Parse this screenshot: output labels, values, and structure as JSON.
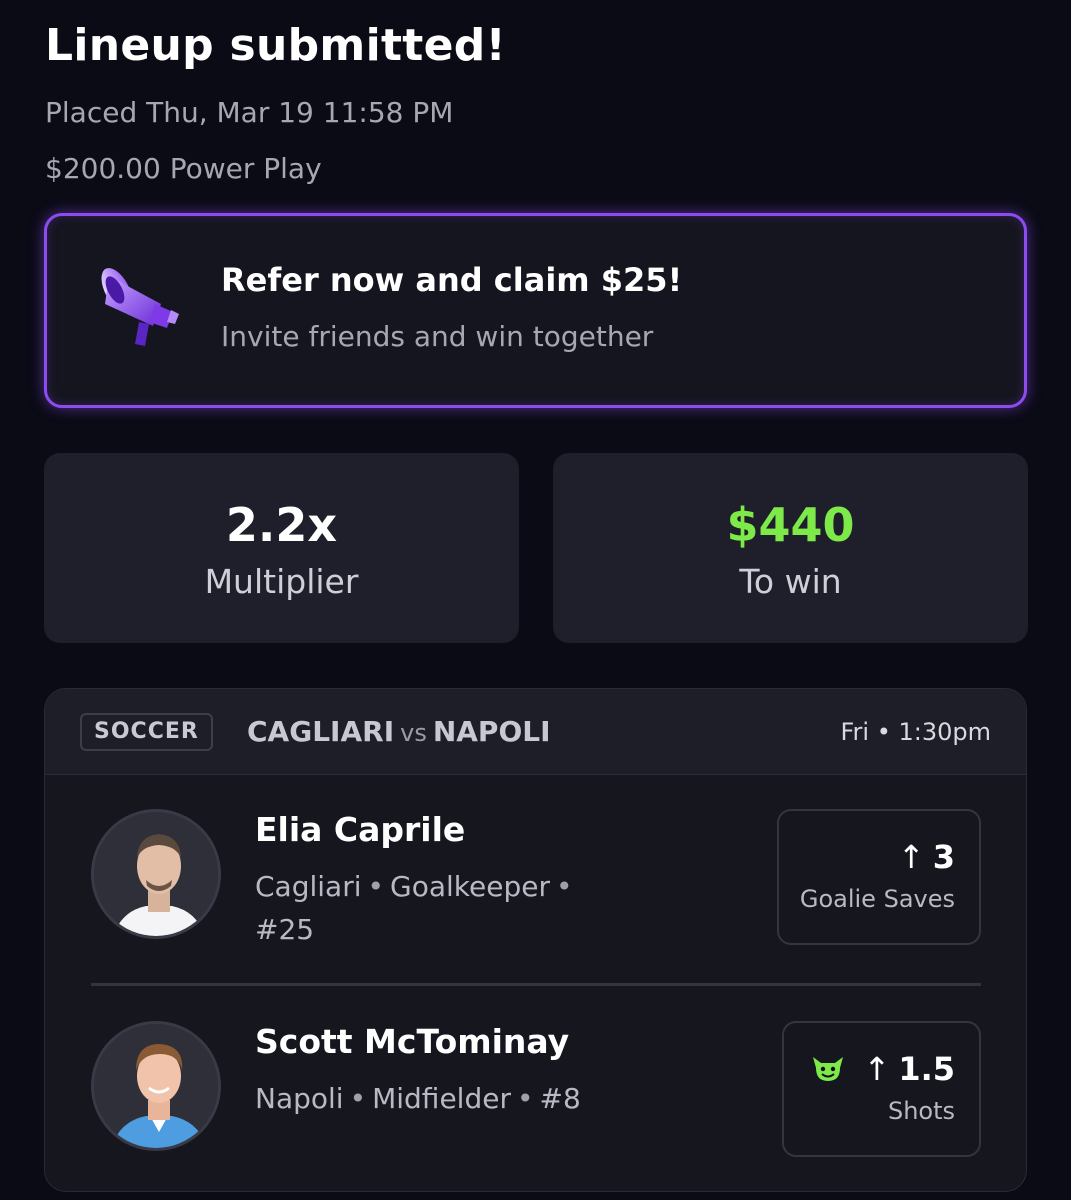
{
  "header": {
    "title": "Lineup submitted!",
    "placed": "Placed Thu, Mar 19 11:58 PM",
    "amount": "$200.00 Power Play"
  },
  "promo": {
    "icon": "megaphone-icon",
    "title": "Refer now and claim $25!",
    "subtitle": "Invite friends and win together",
    "accent_color": "#8d4cf0"
  },
  "stats": {
    "multiplier_value": "2.2x",
    "multiplier_label": "Multiplier",
    "to_win_value": "$440",
    "to_win_label": "To win",
    "to_win_color": "#7dea4a"
  },
  "game": {
    "sport": "SOCCER",
    "home": "CAGLIARI",
    "vs": "vs",
    "away": "NAPOLI",
    "time": "Fri • 1:30pm",
    "players": [
      {
        "name": "Elia Caprile",
        "team": "Cagliari",
        "position": "Goalkeeper",
        "number": "#25",
        "direction": "↑",
        "line": "3",
        "stat": "Goalie Saves",
        "kit_color": "#ffffff"
      },
      {
        "name": "Scott McTominay",
        "team": "Napoli",
        "position": "Midfielder",
        "number": "#8",
        "direction": "↑",
        "line": "1.5",
        "stat": "Shots",
        "badge_icon": "goblin-icon",
        "badge_color": "#7dea4a",
        "kit_color": "#4d9de0"
      }
    ]
  }
}
